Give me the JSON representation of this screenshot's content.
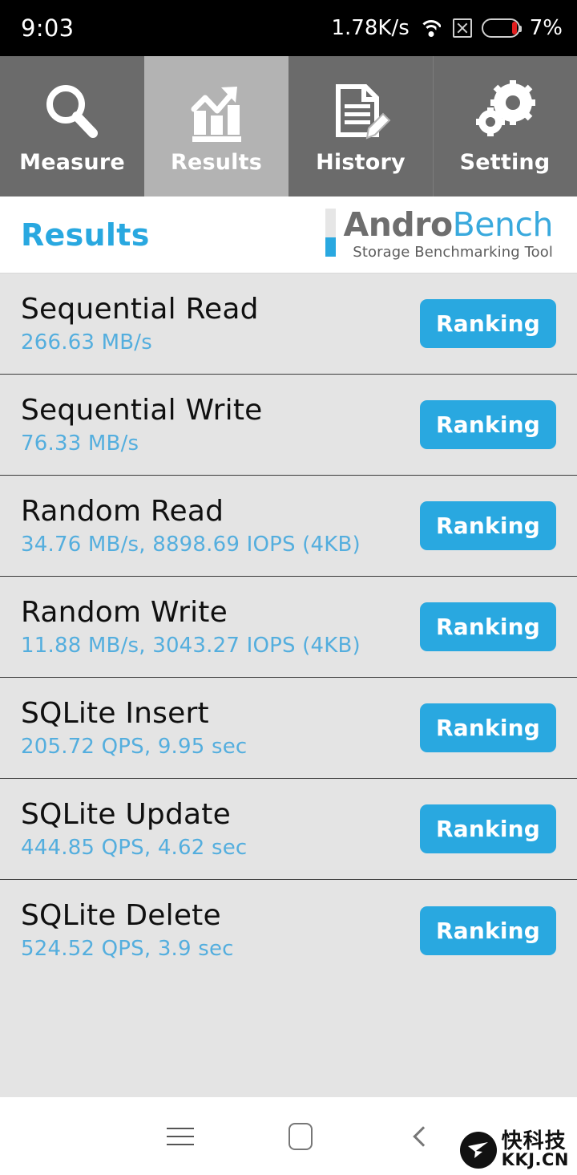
{
  "status_bar": {
    "time": "9:03",
    "network_speed": "1.78K/s",
    "battery_percent": "7%",
    "icons": [
      "wifi-icon",
      "no-sim-icon",
      "battery-icon"
    ]
  },
  "tabs": [
    {
      "label": "Measure",
      "icon": "magnifier-icon",
      "active": false
    },
    {
      "label": "Results",
      "icon": "bar-chart-growth-icon",
      "active": true
    },
    {
      "label": "History",
      "icon": "document-pencil-icon",
      "active": false
    },
    {
      "label": "Setting",
      "icon": "gears-icon",
      "active": false
    }
  ],
  "header": {
    "title": "Results",
    "logo_andro": "Andro",
    "logo_bench": "Bench",
    "logo_tagline": "Storage Benchmarking Tool"
  },
  "results": {
    "ranking_label": "Ranking",
    "rows": [
      {
        "title": "Sequential Read",
        "value": "266.63 MB/s"
      },
      {
        "title": "Sequential Write",
        "value": "76.33 MB/s"
      },
      {
        "title": "Random Read",
        "value": "34.76 MB/s, 8898.69 IOPS (4KB)"
      },
      {
        "title": "Random Write",
        "value": "11.88 MB/s, 3043.27 IOPS (4KB)"
      },
      {
        "title": "SQLite Insert",
        "value": "205.72 QPS, 9.95 sec"
      },
      {
        "title": "SQLite Update",
        "value": "444.85 QPS, 4.62 sec"
      },
      {
        "title": "SQLite Delete",
        "value": "524.52 QPS, 3.9 sec"
      }
    ]
  },
  "navbar": {
    "buttons": [
      "menu-icon",
      "home-icon",
      "back-icon"
    ]
  },
  "watermark": {
    "cn": "快科技",
    "en": "KKJ.CN"
  },
  "colors": {
    "accent_blue": "#29a8e0",
    "value_blue": "#54aede",
    "tab_inactive": "#6b6b6b",
    "tab_active": "#b3b3b3",
    "list_bg": "#e4e4e4"
  }
}
